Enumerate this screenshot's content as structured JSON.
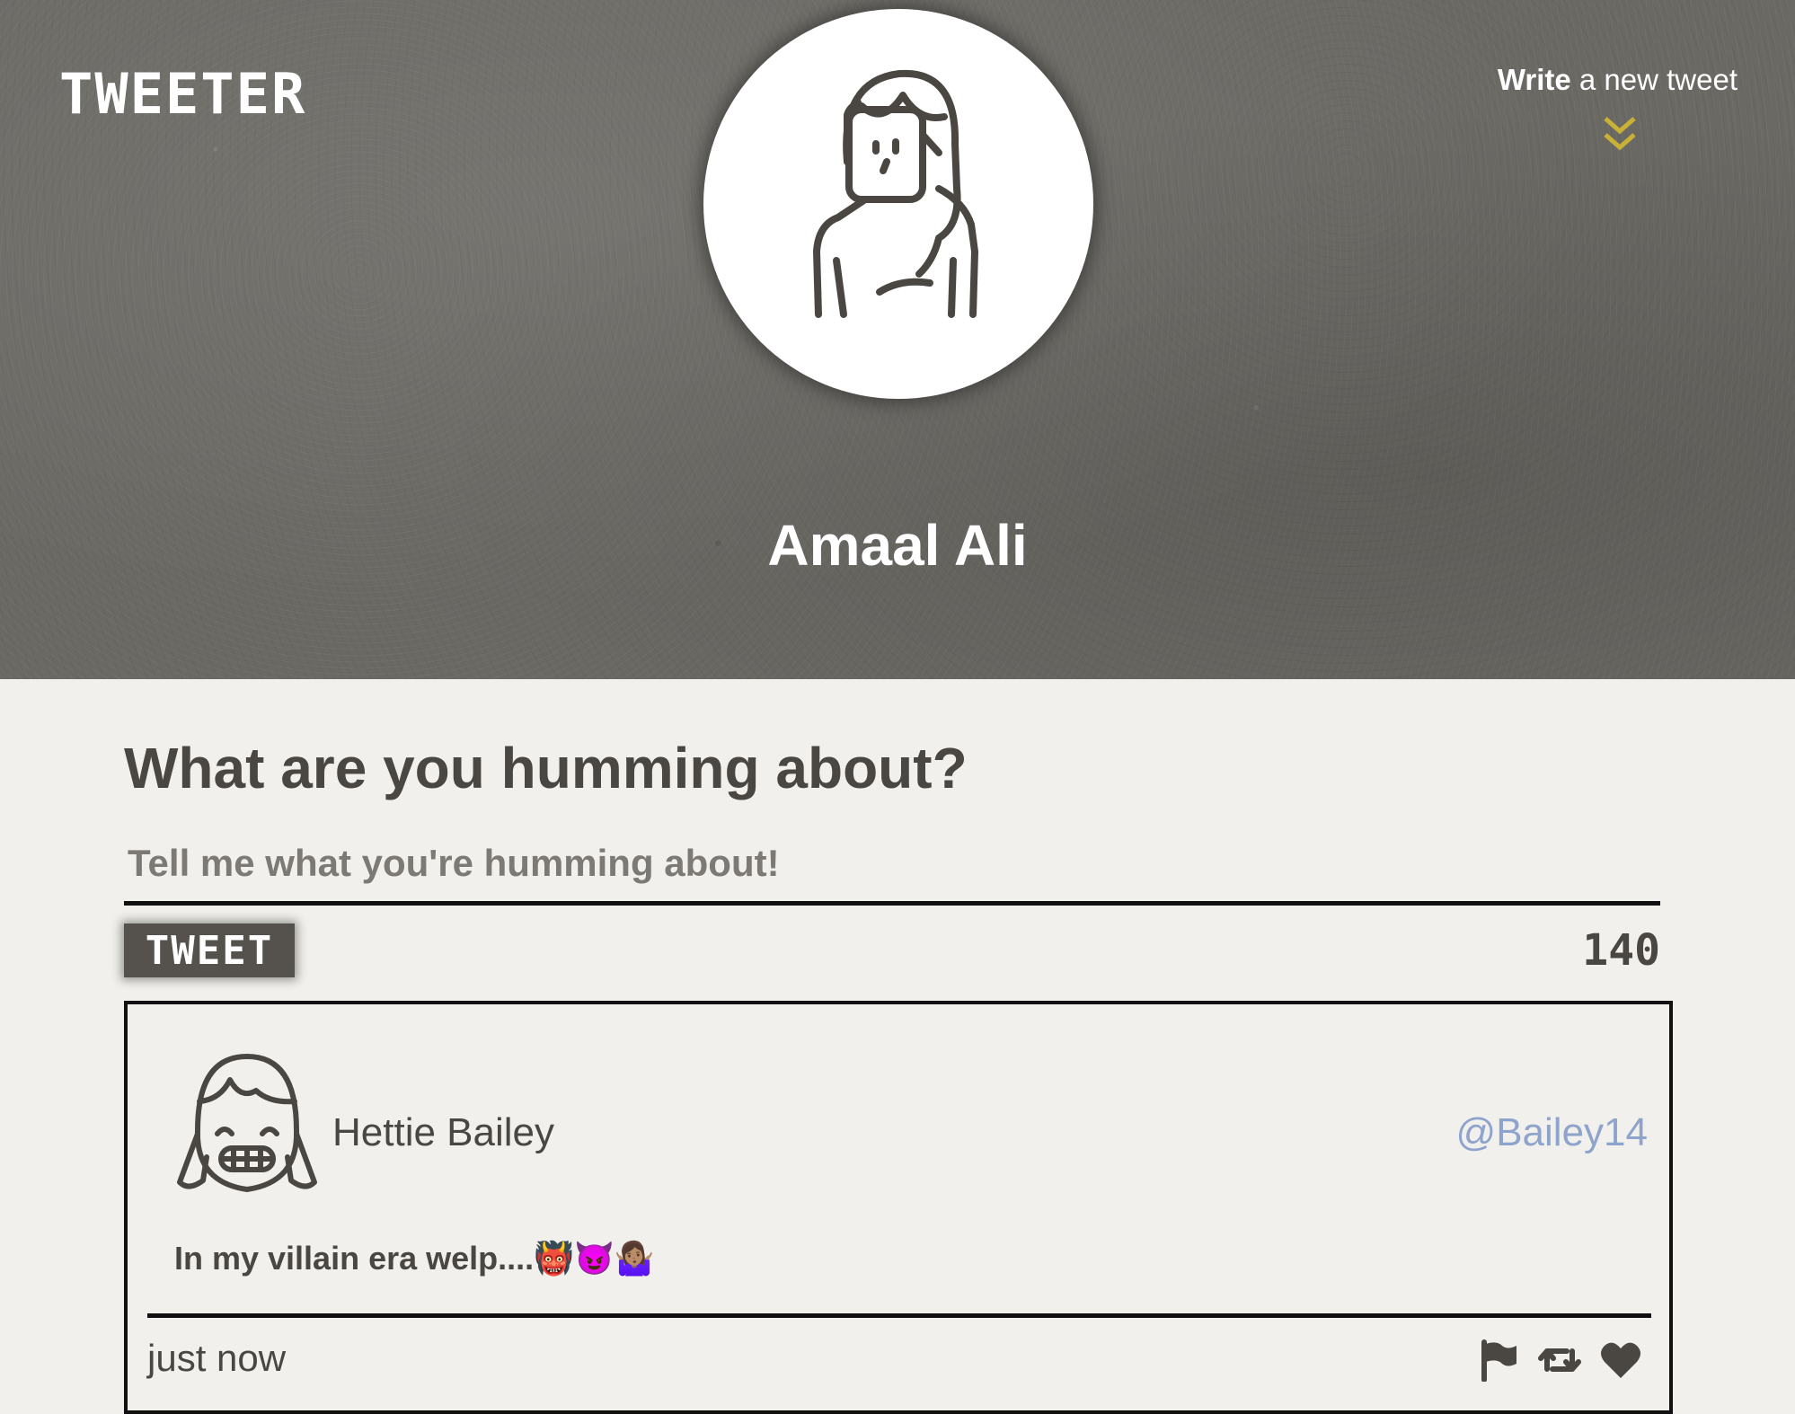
{
  "header": {
    "brand": "TWEETER",
    "write_bold": "Write",
    "write_rest": " a new tweet",
    "profile_name": "Amaal Ali",
    "avatar_icon": "woman-avatar-icon",
    "chevron_icon": "double-chevron-down-icon",
    "accent_color": "#c9b037"
  },
  "compose": {
    "title": "What are you humming about?",
    "placeholder": "Tell me what you're humming about!",
    "button_label": "TWEET",
    "counter": "140"
  },
  "tweets": [
    {
      "author": "Hettie Bailey",
      "handle": "@Bailey14",
      "text": "In my villain era welp....👹😈🤷🏽‍♀️",
      "time": "just now",
      "avatar_icon": "girl-avatar-icon",
      "actions": [
        "flag-icon",
        "retweet-icon",
        "heart-icon"
      ]
    }
  ]
}
